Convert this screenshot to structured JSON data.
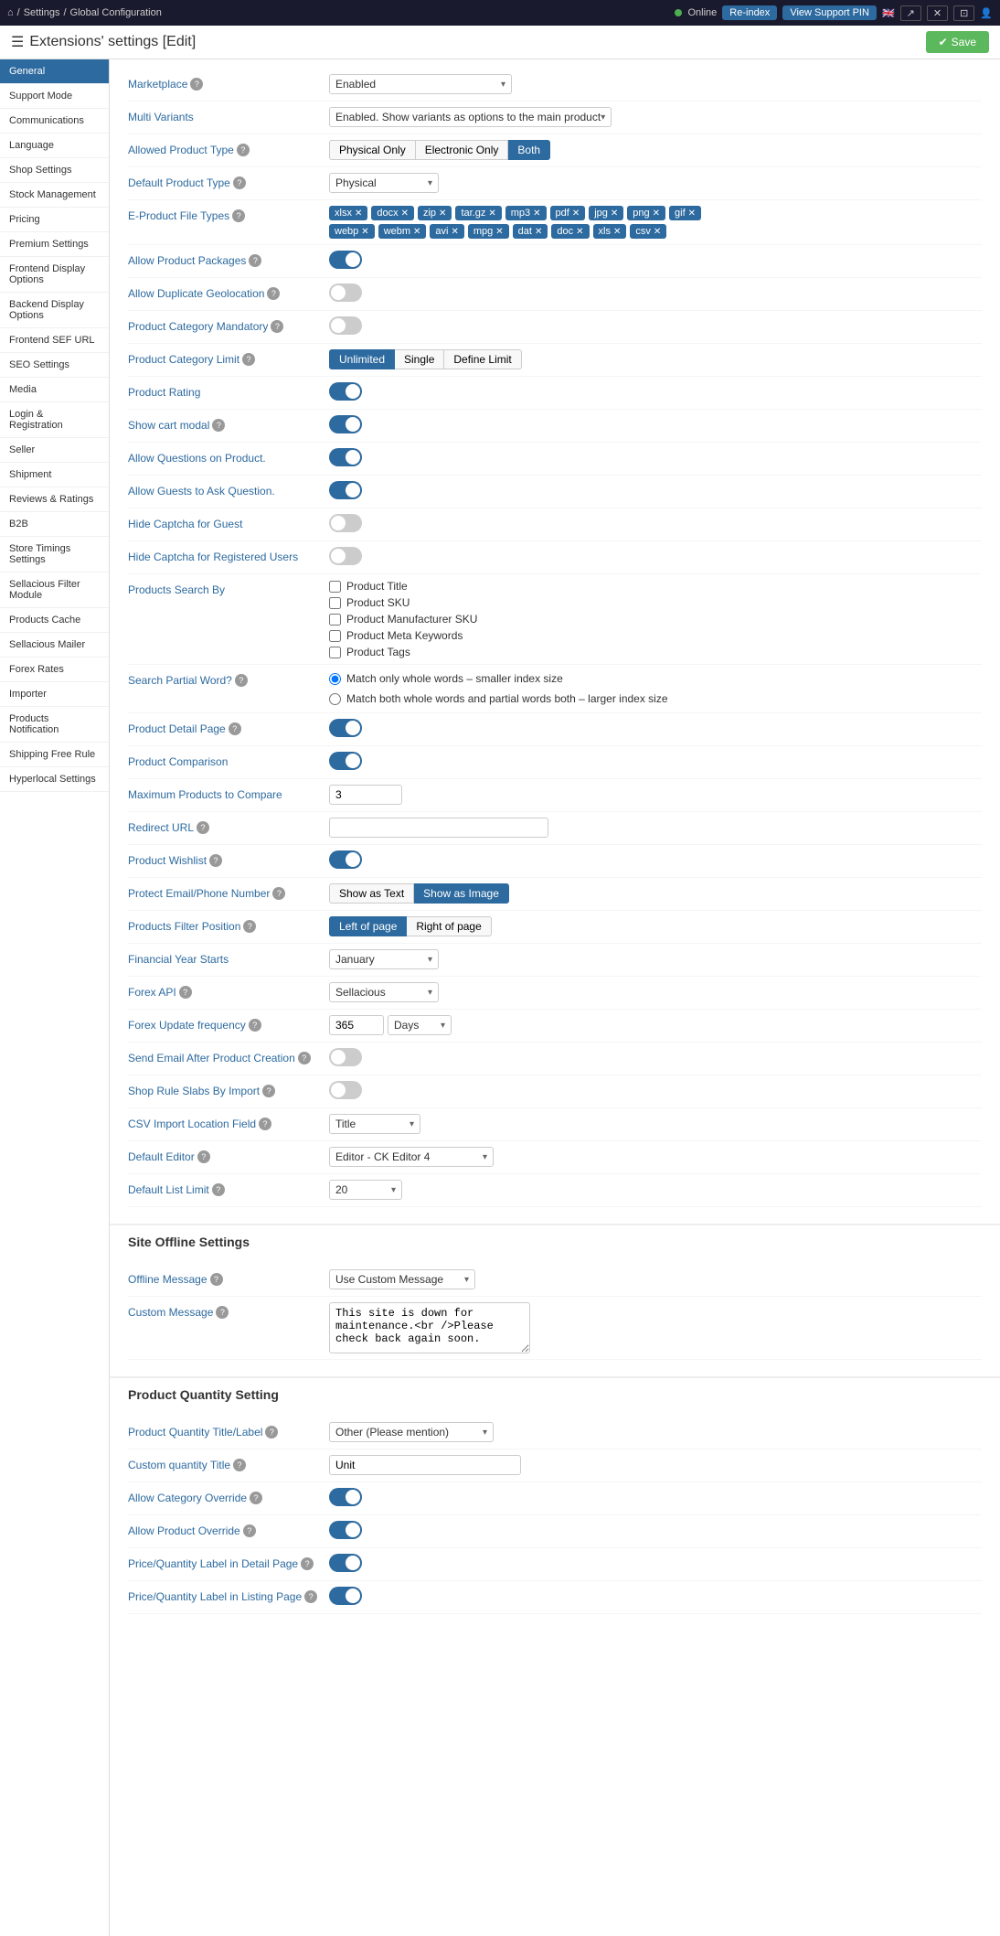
{
  "topbar": {
    "home_icon": "home",
    "breadcrumb": [
      "Settings",
      "Global Configuration"
    ],
    "status_label": "Online",
    "reindex_label": "Re-index",
    "support_pin_label": "View Support PIN",
    "flag": "GB",
    "save_label": "Save"
  },
  "page_title": "Extensions' settings [Edit]",
  "sidebar": {
    "items": [
      {
        "id": "general",
        "label": "General",
        "active": true
      },
      {
        "id": "support-mode",
        "label": "Support Mode",
        "active": false
      },
      {
        "id": "communications",
        "label": "Communications",
        "active": false
      },
      {
        "id": "language",
        "label": "Language",
        "active": false
      },
      {
        "id": "shop-settings",
        "label": "Shop Settings",
        "active": false
      },
      {
        "id": "stock-management",
        "label": "Stock Management",
        "active": false
      },
      {
        "id": "pricing",
        "label": "Pricing",
        "active": false
      },
      {
        "id": "premium-settings",
        "label": "Premium Settings",
        "active": false
      },
      {
        "id": "frontend-display",
        "label": "Frontend Display Options",
        "active": false
      },
      {
        "id": "backend-display",
        "label": "Backend Display Options",
        "active": false
      },
      {
        "id": "frontend-sef",
        "label": "Frontend SEF URL",
        "active": false
      },
      {
        "id": "seo-settings",
        "label": "SEO Settings",
        "active": false
      },
      {
        "id": "media",
        "label": "Media",
        "active": false
      },
      {
        "id": "login-registration",
        "label": "Login & Registration",
        "active": false
      },
      {
        "id": "seller",
        "label": "Seller",
        "active": false
      },
      {
        "id": "shipment",
        "label": "Shipment",
        "active": false
      },
      {
        "id": "reviews-ratings",
        "label": "Reviews & Ratings",
        "active": false
      },
      {
        "id": "b2b",
        "label": "B2B",
        "active": false
      },
      {
        "id": "store-timings",
        "label": "Store Timings Settings",
        "active": false
      },
      {
        "id": "sellacious-filter",
        "label": "Sellacious Filter Module",
        "active": false
      },
      {
        "id": "products-cache",
        "label": "Products Cache",
        "active": false
      },
      {
        "id": "sellacious-mailer",
        "label": "Sellacious Mailer",
        "active": false
      },
      {
        "id": "forex-rates",
        "label": "Forex Rates",
        "active": false
      },
      {
        "id": "importer",
        "label": "Importer",
        "active": false
      },
      {
        "id": "products-notification",
        "label": "Products Notification",
        "active": false
      },
      {
        "id": "shipping-free-rule",
        "label": "Shipping Free Rule",
        "active": false
      },
      {
        "id": "hyperlocal-settings",
        "label": "Hyperlocal Settings",
        "active": false
      }
    ]
  },
  "form": {
    "marketplace_label": "Marketplace",
    "marketplace_value": "Enabled",
    "multi_variants_label": "Multi Variants",
    "multi_variants_value": "Enabled. Show variants as options to the main product",
    "allowed_product_type_label": "Allowed Product Type",
    "product_types": [
      "Physical Only",
      "Electronic Only",
      "Both"
    ],
    "product_types_active": "Both",
    "default_product_type_label": "Default Product Type",
    "default_product_type_value": "Physical",
    "e_product_file_types_label": "E-Product File Types",
    "file_types": [
      "xlsx",
      "docx",
      "zip",
      "tar.gz",
      "mp3",
      "pdf",
      "jpg",
      "png",
      "gif",
      "webp",
      "webm",
      "avi",
      "mpg",
      "dat",
      "doc",
      "xls",
      "csv"
    ],
    "allow_product_packages_label": "Allow Product Packages",
    "allow_product_packages": true,
    "allow_duplicate_geolocation_label": "Allow Duplicate Geolocation",
    "allow_duplicate_geolocation": false,
    "product_category_mandatory_label": "Product Category Mandatory",
    "product_category_mandatory": false,
    "product_category_limit_label": "Product Category Limit",
    "category_limits": [
      "Unlimited",
      "Single",
      "Define Limit"
    ],
    "category_limit_active": "Unlimited",
    "product_rating_label": "Product Rating",
    "product_rating": true,
    "show_cart_modal_label": "Show cart modal",
    "show_cart_modal": true,
    "allow_questions_label": "Allow Questions on Product.",
    "allow_questions": true,
    "allow_guests_ask_label": "Allow Guests to Ask Question.",
    "allow_guests_ask": true,
    "hide_captcha_guest_label": "Hide Captcha for Guest",
    "hide_captcha_guest": false,
    "hide_captcha_registered_label": "Hide Captcha for Registered Users",
    "hide_captcha_registered": false,
    "products_search_by_label": "Products Search By",
    "search_options": [
      "Product Title",
      "Product SKU",
      "Product Manufacturer SKU",
      "Product Meta Keywords",
      "Product Tags"
    ],
    "search_partial_word_label": "Search Partial Word?",
    "search_partial_options": [
      "Match only whole words – smaller index size",
      "Match both whole words and partial words both – larger index size"
    ],
    "search_partial_active": 0,
    "product_detail_page_label": "Product Detail Page",
    "product_detail_page": true,
    "product_comparison_label": "Product Comparison",
    "product_comparison": true,
    "max_products_compare_label": "Maximum Products to Compare",
    "max_products_compare_value": "3",
    "redirect_url_label": "Redirect URL",
    "redirect_url_value": "",
    "product_wishlist_label": "Product Wishlist",
    "product_wishlist": true,
    "protect_email_label": "Protect Email/Phone Number",
    "protect_options": [
      "Show as Text",
      "Show as Image"
    ],
    "protect_active": "Show as Image",
    "products_filter_position_label": "Products Filter Position",
    "filter_positions": [
      "Left of page",
      "Right of page"
    ],
    "filter_position_active": "Left of page",
    "financial_year_label": "Financial Year Starts",
    "financial_year_value": "January",
    "forex_api_label": "Forex API",
    "forex_api_value": "Sellacious",
    "forex_update_label": "Forex Update frequency",
    "forex_update_value": "365",
    "forex_update_unit": "Days",
    "send_email_label": "Send Email After Product Creation",
    "send_email": false,
    "shop_rule_slabs_label": "Shop Rule Slabs By Import",
    "shop_rule_slabs": false,
    "csv_import_location_label": "CSV Import Location Field",
    "csv_import_value": "Title",
    "default_editor_label": "Default Editor",
    "default_editor_value": "Editor - CK Editor 4",
    "default_list_limit_label": "Default List Limit",
    "default_list_limit_value": "20",
    "site_offline_title": "Site Offline Settings",
    "offline_message_label": "Offline Message",
    "offline_message_value": "Use Custom Message",
    "custom_message_label": "Custom Message",
    "custom_message_value": "This site is down for maintenance.<br />Please check back again soon.",
    "product_quantity_title": "Product Quantity Setting",
    "product_qty_title_label_label": "Product Quantity Title/Label",
    "product_qty_title_label_value": "Other (Please mention)",
    "custom_qty_title_label": "Custom quantity Title",
    "custom_qty_title_value": "Unit",
    "allow_category_override_label": "Allow Category Override",
    "allow_category_override": true,
    "allow_product_override_label": "Allow Product Override",
    "allow_product_override": true,
    "price_qty_detail_label": "Price/Quantity Label in Detail Page",
    "price_qty_detail": true,
    "price_qty_listing_label": "Price/Quantity Label in Listing Page",
    "price_qty_listing": true
  }
}
